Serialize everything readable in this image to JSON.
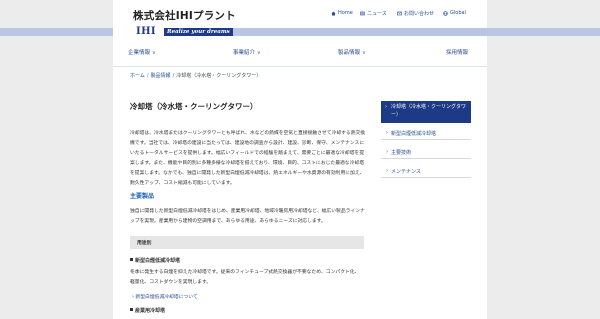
{
  "header": {
    "company": "株式会社IHIプラント",
    "util": [
      {
        "label": "Home",
        "icon": "home-icon"
      },
      {
        "label": "ニュース",
        "icon": "news-icon"
      },
      {
        "label": "お問い合わせ",
        "icon": "mail-icon"
      },
      {
        "label": "Global",
        "icon": "globe-icon"
      }
    ]
  },
  "brand": {
    "logo": "IHI",
    "tagline": "Realize your dreams",
    "color": "#1c3a86",
    "band_color": "#b9c6e2"
  },
  "gnav": [
    "企業情報",
    "事業紹介",
    "製品情報",
    "採用情報"
  ],
  "breadcrumb": {
    "items": [
      "ホーム",
      "製品情報",
      "冷却塔（冷水塔・クーリングタワー）"
    ]
  },
  "main": {
    "title": "冷却塔（冷水塔・クーリングタワー）",
    "intro": "冷却塔は、冷水塔またはクーリングタワーとも呼ばれ、水などの熱媒を空気と直接接触させて冷却する熱交換機です。当社では、冷却塔の建設に当たっては、建設地の調査から設計、建設、診断、保守、メンテナンスにいたるトータルサービスを提供します。幅広いフィールドでの経験を踏まえて、需要ごとに最適な冷却塔を提案します。また、機能や目的別に多種多様な冷却塔を揃えており、環境、目的、コストにおじた最適な冷却塔を提案します。なかでも、独自に開発した新型白煙低減冷却塔は、熱エネルギーや水資源の有効利用に加え、耐久性アップ、コスト縮減も可能にしています。",
    "section_title": "主要製品",
    "section_text": "独自に開発した新型白煙低減冷却塔をはじめ、産業用冷却塔、地域冷暖房用冷却塔など、幅広い製品ラインナップを実現。産業用から建物の空調用まで、あらゆる用途、あらゆるニーズに対応します。",
    "bar_label": "用途別",
    "product1": "新型白煙低減冷却塔",
    "product1_text": "冬季に発生する白煙を抑えた冷却塔です。従来のフィンチューブ式熱交換器が不要なため、コンパクト化、軽量化、コストダウンを実現します。",
    "product1_link": "新型白煙低減冷却塔について",
    "product2": "産業用冷却塔"
  },
  "sidebar": {
    "head": "冷却塔（冷水塔・クーリングタワー）",
    "items": [
      "新型白煙低減冷却塔",
      "主要技術",
      "メンテナンス"
    ]
  }
}
